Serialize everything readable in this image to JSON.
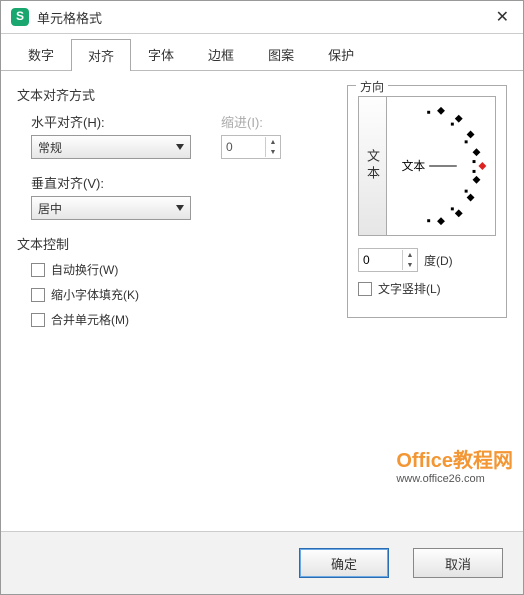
{
  "window": {
    "title": "单元格格式"
  },
  "tabs": [
    "数字",
    "对齐",
    "字体",
    "边框",
    "图案",
    "保护"
  ],
  "activeTabIndex": 1,
  "align": {
    "section": "文本对齐方式",
    "hLabel": "水平对齐(H):",
    "hValue": "常规",
    "vLabel": "垂直对齐(V):",
    "vValue": "居中",
    "indentLabel": "缩进(I):",
    "indentValue": "0"
  },
  "textCtrl": {
    "section": "文本控制",
    "wrap": "自动换行(W)",
    "shrink": "缩小字体填充(K)",
    "merge": "合并单元格(M)"
  },
  "orient": {
    "section": "方向",
    "verticalText": "文本",
    "sampleText": "文本",
    "degValue": "0",
    "degLabel": "度(D)",
    "stack": "文字竖排(L)"
  },
  "buttons": {
    "ok": "确定",
    "cancel": "取消"
  },
  "watermark": {
    "line1": "Office教程网",
    "line2": "www.office26.com"
  }
}
